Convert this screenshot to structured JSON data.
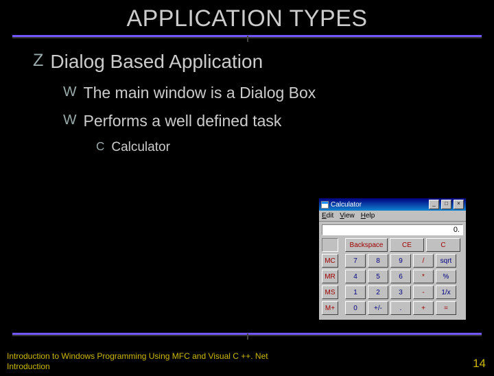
{
  "title": "APPLICATION TYPES",
  "bullets": {
    "l1": {
      "glyph": "Z",
      "text": "Dialog Based Application"
    },
    "l2a": {
      "glyph": "W",
      "text": "The main window is a Dialog Box"
    },
    "l2b": {
      "glyph": "W",
      "text": "Performs a well defined task"
    },
    "l3": {
      "glyph": "C",
      "text": "Calculator"
    }
  },
  "footer": {
    "line1": "Introduction to Windows Programming Using MFC and Visual C ++. Net",
    "line2": "Introduction"
  },
  "page_number": "14",
  "calculator": {
    "title": "Calculator",
    "menu": {
      "edit": "Edit",
      "view": "View",
      "help": "Help"
    },
    "display": "0.",
    "top_row": {
      "backspace": "Backspace",
      "ce": "CE",
      "c": "C"
    },
    "mem": {
      "mc": "MC",
      "mr": "MR",
      "ms": "MS",
      "mp": "M+"
    },
    "keys": {
      "r1": [
        "7",
        "8",
        "9",
        "/",
        "sqrt"
      ],
      "r2": [
        "4",
        "5",
        "6",
        "*",
        "%"
      ],
      "r3": [
        "1",
        "2",
        "3",
        "-",
        "1/x"
      ],
      "r4": [
        "0",
        "+/-",
        ".",
        "+",
        "="
      ]
    },
    "title_buttons": {
      "min": "_",
      "max": "□",
      "close": "×"
    }
  }
}
